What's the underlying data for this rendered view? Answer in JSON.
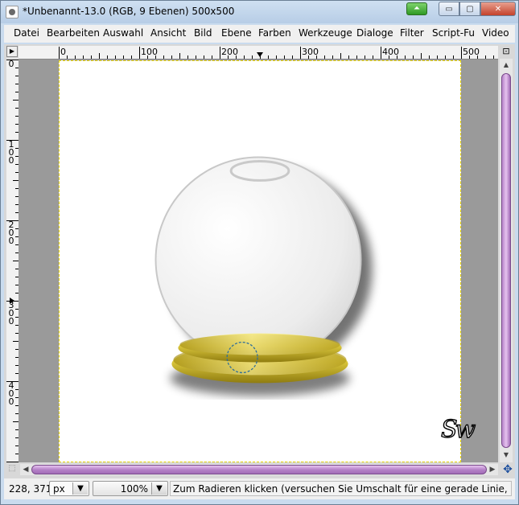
{
  "window": {
    "title": "*Unbenannt-13.0 (RGB, 9 Ebenen) 500x500",
    "caption": {
      "minimize": "▭",
      "maximize": "▢",
      "close": "✕"
    }
  },
  "menu": [
    {
      "label": "Datei"
    },
    {
      "label": "Bearbeiten"
    },
    {
      "label": "Auswahl"
    },
    {
      "label": "Ansicht"
    },
    {
      "label": "Bild"
    },
    {
      "label": "Ebene"
    },
    {
      "label": "Farben"
    },
    {
      "label": "Werkzeuge"
    },
    {
      "label": "Dialoge"
    },
    {
      "label": "Filter"
    },
    {
      "label": "Script-Fu"
    },
    {
      "label": "Video"
    }
  ],
  "ruler": {
    "h_labels": [
      "0",
      "100",
      "200",
      "300",
      "400",
      "500"
    ],
    "v_labels": [
      "0",
      "100",
      "200",
      "300",
      "400"
    ]
  },
  "canvas": {
    "signature": "Sw",
    "colors": {
      "glass": "#e9e9e9",
      "gold": "#d4c13a",
      "background": "#ffffff"
    }
  },
  "statusbar": {
    "coords": "228, 371",
    "unit": "px",
    "zoom": "100%",
    "message": "Zum Radieren klicken (versuchen Sie Umschalt für eine gerade Linie, Strg zum ..."
  }
}
